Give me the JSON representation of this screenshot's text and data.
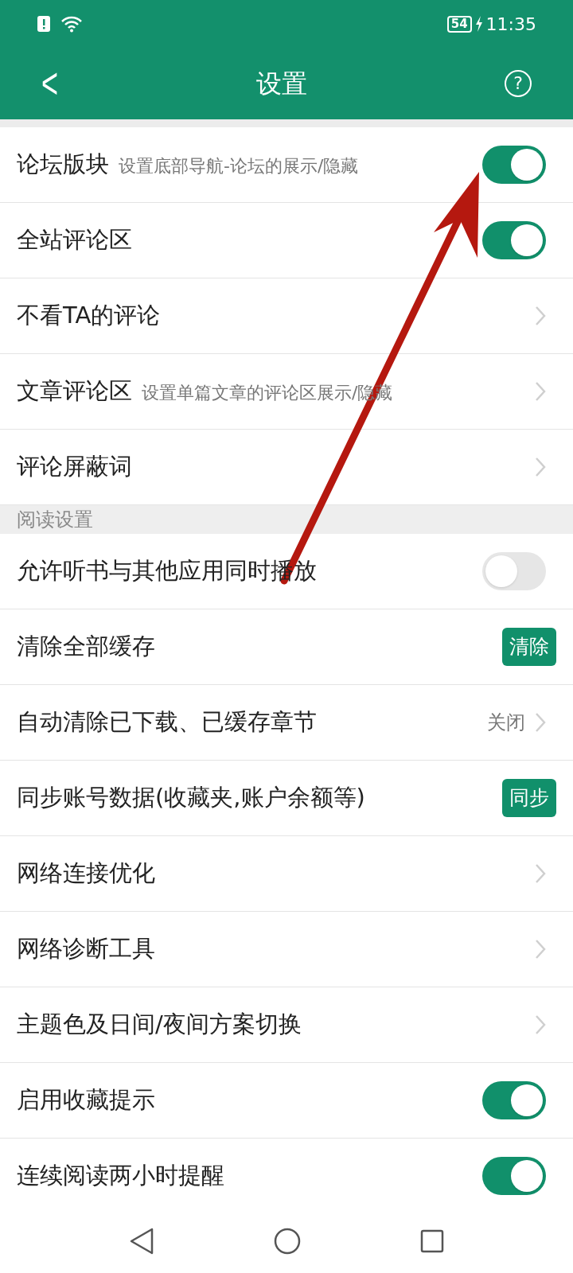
{
  "status_bar": {
    "battery": "54",
    "time": "11:35"
  },
  "header": {
    "back": "<",
    "title": "设置",
    "help": "?"
  },
  "sections": [
    {
      "items": [
        {
          "kind": "toggle",
          "label": "论坛版块",
          "hint": "设置底部导航-论坛的展示/隐藏",
          "on": true
        },
        {
          "kind": "toggle",
          "label": "全站评论区",
          "on": true
        },
        {
          "kind": "link",
          "label": "不看TA的评论"
        },
        {
          "kind": "link",
          "label": "文章评论区",
          "hint": "设置单篇文章的评论区展示/隐藏"
        },
        {
          "kind": "link",
          "label": "评论屏蔽词"
        }
      ]
    },
    {
      "title": "阅读设置",
      "items": [
        {
          "kind": "toggle",
          "label": "允许听书与其他应用同时播放",
          "on": false
        },
        {
          "kind": "button",
          "label": "清除全部缓存",
          "action": "清除"
        },
        {
          "kind": "link",
          "label": "自动清除已下载、已缓存章节",
          "value": "关闭"
        },
        {
          "kind": "button",
          "label": "同步账号数据(收藏夹,账户余额等)",
          "action": "同步"
        },
        {
          "kind": "link",
          "label": "网络连接优化"
        },
        {
          "kind": "link",
          "label": "网络诊断工具"
        },
        {
          "kind": "link",
          "label": "主题色及日间/夜间方案切换"
        },
        {
          "kind": "toggle",
          "label": "启用收藏提示",
          "on": true
        },
        {
          "kind": "toggle",
          "label": "连续阅读两小时提醒",
          "on": true
        }
      ]
    }
  ]
}
